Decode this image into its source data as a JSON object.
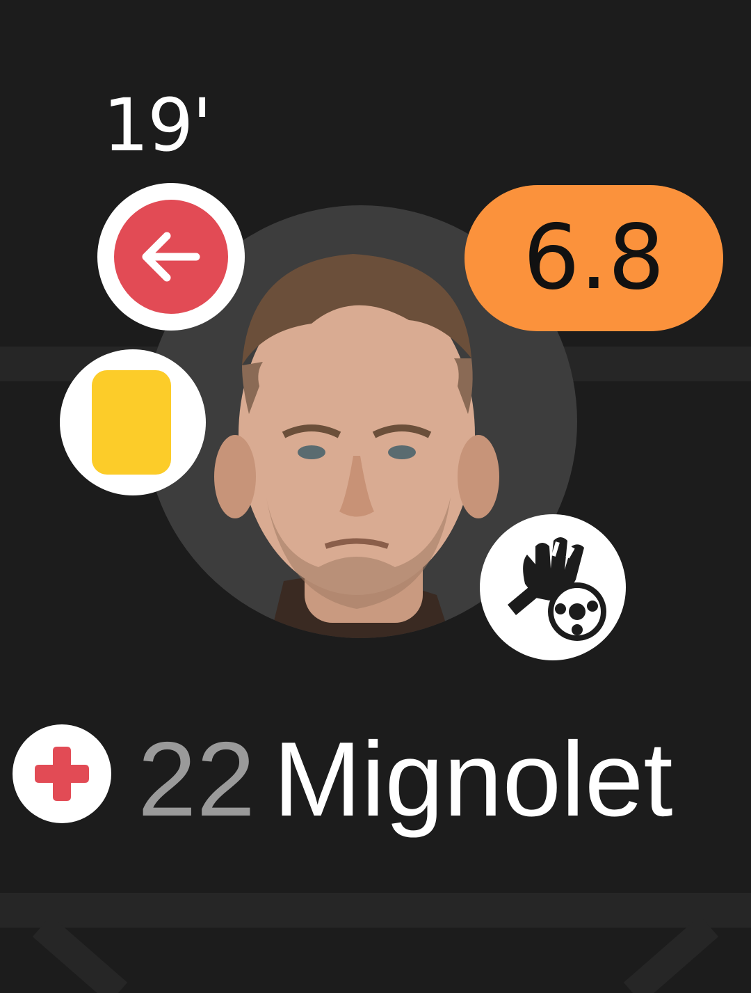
{
  "player": {
    "substitution_minute": "19'",
    "rating": "6.8",
    "shirt_number": "22",
    "name": "Mignolet"
  },
  "icons": {
    "substitution": "arrow-left-icon",
    "card": "yellow-card-icon",
    "event": "goalkeeper-glove-save-icon",
    "status": "injury-cross-icon"
  },
  "colors": {
    "background": "#1c1c1c",
    "substitution_off": "#e24b55",
    "yellow_card": "#fccc29",
    "rating_pill": "#fb923c",
    "injury": "#e24b55",
    "shirt_number": "#9a9a9a",
    "name": "#ffffff"
  }
}
